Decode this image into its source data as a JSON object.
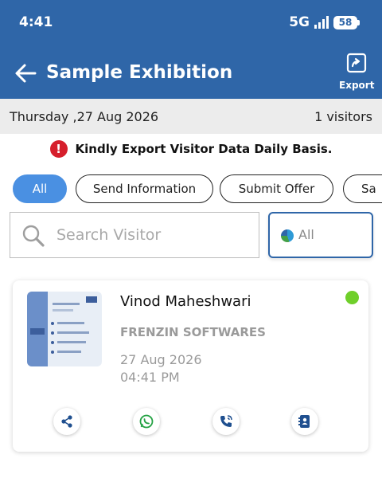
{
  "status_bar": {
    "time": "4:41",
    "network": "5G",
    "battery": "58"
  },
  "app_bar": {
    "title": "Sample Exhibition",
    "export_label": "Export"
  },
  "summary": {
    "date": "Thursday ,27 Aug 2026",
    "visitors": "1  visitors"
  },
  "notice": {
    "text": "Kindly Export Visitor Data Daily Basis.",
    "icon": "alert-icon"
  },
  "filters": [
    {
      "label": "All",
      "active": true
    },
    {
      "label": "Send Information",
      "active": false
    },
    {
      "label": "Submit Offer",
      "active": false
    },
    {
      "label": "Sa",
      "active": false
    }
  ],
  "search": {
    "placeholder": "Search Visitor",
    "value": ""
  },
  "status_filter": {
    "label": "All"
  },
  "visitor": {
    "name": "Vinod Maheshwari",
    "company": "FRENZIN SOFTWARES",
    "date": "27 Aug 2026",
    "time": "04:41 PM",
    "status_color": "#6fcf2a",
    "actions": [
      "share-icon",
      "whatsapp-icon",
      "phone-call-icon",
      "contact-book-icon"
    ]
  },
  "colors": {
    "primary": "#2f66a8",
    "chip_active": "#4a90e2",
    "alert": "#d61f2c"
  }
}
